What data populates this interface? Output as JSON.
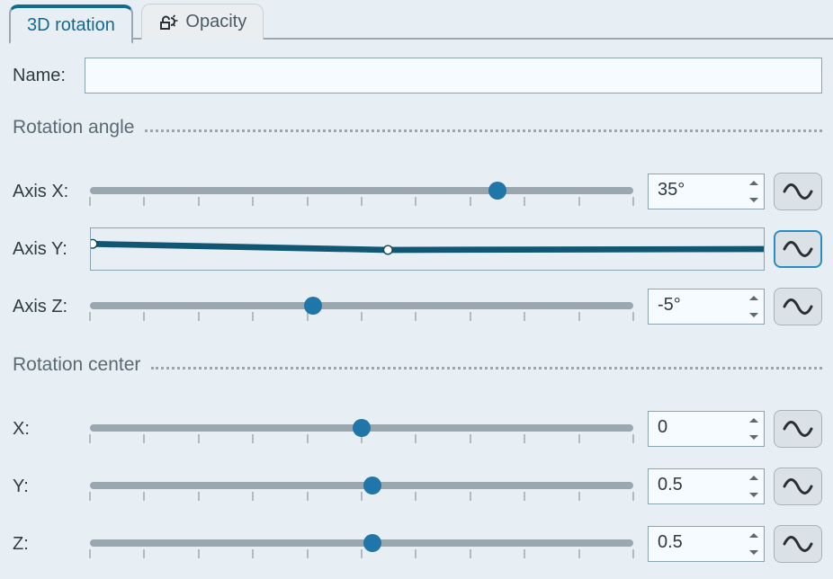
{
  "tabs": {
    "rotation": "3D rotation",
    "opacity": "Opacity"
  },
  "name": {
    "label": "Name:",
    "value": ""
  },
  "groups": {
    "angle": "Rotation angle",
    "center": "Rotation center"
  },
  "rows": {
    "axis_x": {
      "label": "Axis X:",
      "value": "35°",
      "pos": 0.75,
      "wave_active": false
    },
    "axis_y": {
      "label": "Axis Y:",
      "wave_active": true
    },
    "axis_z": {
      "label": "Axis Z:",
      "value": "-5°",
      "pos": 0.41,
      "wave_active": false
    },
    "cx": {
      "label": "X:",
      "value": "0",
      "pos": 0.5,
      "wave_active": false
    },
    "cy": {
      "label": "Y:",
      "value": "0.5",
      "pos": 0.52,
      "wave_active": false
    },
    "cz": {
      "label": "Z:",
      "value": "0.5",
      "pos": 0.52,
      "wave_active": false
    }
  }
}
